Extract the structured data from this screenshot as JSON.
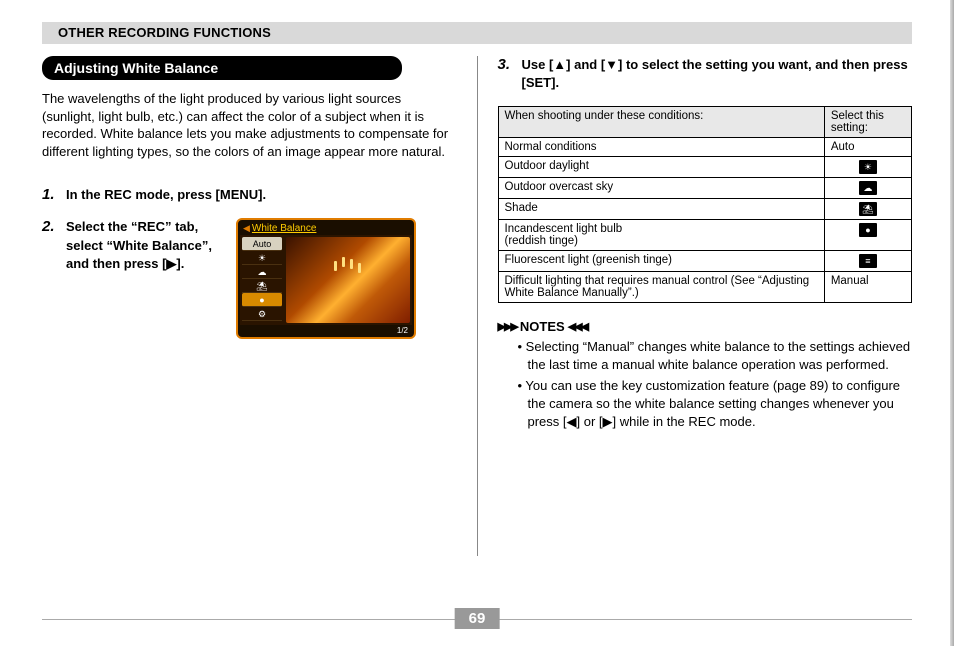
{
  "header": {
    "title": "OTHER RECORDING FUNCTIONS"
  },
  "section": {
    "heading": "Adjusting White Balance"
  },
  "intro": "The wavelengths of the light produced by various light sources (sunlight, light bulb, etc.) can affect the color of a subject when it is recorded. White balance lets you make adjustments to compensate for different lighting types, so the colors of an image appear more natural.",
  "steps": {
    "s1": {
      "num": "1.",
      "text": "In the REC mode, press [MENU]."
    },
    "s2": {
      "num": "2.",
      "text": "Select the “REC” tab, select “White Balance”, and then press [▶]."
    },
    "s3": {
      "num": "3.",
      "text": "Use [▲] and [▼] to select the setting you want, and then press [SET]."
    }
  },
  "lcd": {
    "title_prefix": "◀",
    "title": "White Balance",
    "options": [
      "Auto",
      "☀",
      "☁",
      "⛱",
      "●",
      "⚙"
    ],
    "selected_index": 4,
    "footer": "1/2"
  },
  "table": {
    "head": {
      "c1": "When shooting under these conditions:",
      "c2": "Select this setting:"
    },
    "rows": [
      {
        "c1": "Normal conditions",
        "c2": "Auto",
        "icon": false
      },
      {
        "c1": "Outdoor daylight",
        "c2": "☀",
        "icon": true
      },
      {
        "c1": "Outdoor overcast sky",
        "c2": "☁",
        "icon": true
      },
      {
        "c1": "Shade",
        "c2": "⛱",
        "icon": true
      },
      {
        "c1": "Incandescent light bulb\n(reddish tinge)",
        "c2": "●",
        "icon": true
      },
      {
        "c1": "Fluorescent light (greenish tinge)",
        "c2": "≡",
        "icon": true
      },
      {
        "c1": "Difficult lighting that requires manual control (See “Adjusting White Balance Manually”.)",
        "c2": "Manual",
        "icon": false
      }
    ]
  },
  "notes": {
    "label": "NOTES",
    "deco_l": "▶▶▶",
    "deco_r": "◀◀◀",
    "items": [
      "• Selecting “Manual” changes white balance to the settings achieved the last time a manual white balance operation was performed.",
      "• You can use the key customization feature (page 89) to configure the camera so the white balance setting changes whenever you press [◀] or [▶] while in the REC mode."
    ]
  },
  "page_number": "69"
}
